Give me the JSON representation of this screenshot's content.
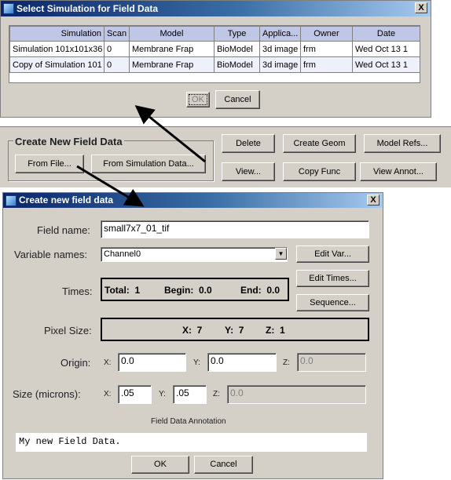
{
  "select_dialog": {
    "title": "Select Simulation for Field Data",
    "close_label": "X",
    "columns": [
      "Simulation",
      "Scan",
      "Model",
      "Type",
      "Applica...",
      "Owner",
      "Date"
    ],
    "rows": [
      [
        "Simulation 101x101x36",
        "0",
        "Membrane Frap",
        "BioModel",
        "3d image",
        "frm",
        "Wed Oct 13 1"
      ],
      [
        "Copy of Simulation 101",
        "0",
        "Membrane Frap",
        "BioModel",
        "3d image",
        "frm",
        "Wed Oct 13 1"
      ]
    ],
    "ok_label": "OK",
    "cancel_label": "Cancel"
  },
  "manager_panel": {
    "group_title": "Create New Field Data",
    "from_file_label": "From File...",
    "from_sim_label": "From Simulation Data...",
    "delete_label": "Delete",
    "create_geom_label": "Create Geom",
    "model_refs_label": "Model Refs...",
    "view_label": "View...",
    "copy_func_label": "Copy Func",
    "view_annot_label": "View Annot..."
  },
  "create_dialog": {
    "title": "Create new field data",
    "close_label": "X",
    "field_name_label": "Field name:",
    "field_name_value": "small7x7_01_tif",
    "variable_names_label": "Variable names:",
    "variable_selected": "Channel0",
    "edit_var_label": "Edit Var...",
    "edit_times_label": "Edit Times...",
    "sequence_label": "Sequence...",
    "times_label": "Times:",
    "times_total": "Total:  1",
    "times_begin": "Begin:  0.0",
    "times_end": "End:  0.0",
    "pixel_size_label": "Pixel Size:",
    "pixel_x": "X:  7",
    "pixel_y": "Y:  7",
    "pixel_z": "Z:  1",
    "origin_label": "Origin:",
    "origin_x_label": "X:",
    "origin_x": "0.0",
    "origin_y_label": "Y:",
    "origin_y": "0.0",
    "origin_z_label": "Z:",
    "origin_z": "0.0",
    "size_label": "Size (microns):",
    "size_x_label": "X:",
    "size_x": ".05",
    "size_y_label": "Y:",
    "size_y": ".05",
    "size_z_label": "Z:",
    "size_z": "0.0",
    "annotation_label": "Field Data Annotation",
    "annotation_value": "My new Field Data.",
    "ok_label": "OK",
    "cancel_label": "Cancel"
  },
  "colors": {
    "title_start": "#0a246a",
    "title_end": "#a6caf0",
    "window_bg": "#d4d0c8",
    "table_header": "#c0c7e6"
  }
}
